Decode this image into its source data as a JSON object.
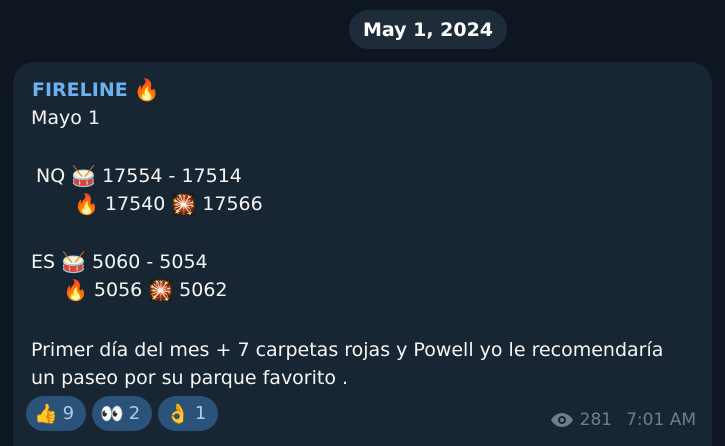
{
  "date_chip": "May 1, 2024",
  "channel": {
    "name": "FIRELINE",
    "name_emoji": "🔥"
  },
  "message": {
    "lines": [
      {
        "text": "Mayo 1"
      },
      {
        "label": "NQ",
        "drum": "🥁",
        "range": "17554 - 17514"
      },
      {
        "fire": "🔥",
        "value1": "17540",
        "firework": "🎇",
        "value2": "17566"
      },
      {
        "label": "ES",
        "drum": "🥁",
        "range": "5060 - 5054"
      },
      {
        "fire": "🔥",
        "value1": "5056",
        "firework": "🎇",
        "value2": "5062"
      }
    ],
    "body": "Primer día del mes + 7 carpetas rojas y Powell yo le recomendaría un paseo por su parque favorito ."
  },
  "reactions": [
    {
      "emoji": "👍",
      "count": "9"
    },
    {
      "emoji": "👀",
      "count": "2"
    },
    {
      "emoji": "👌",
      "count": "1"
    }
  ],
  "meta": {
    "views": "281",
    "time": "7:01 AM"
  }
}
